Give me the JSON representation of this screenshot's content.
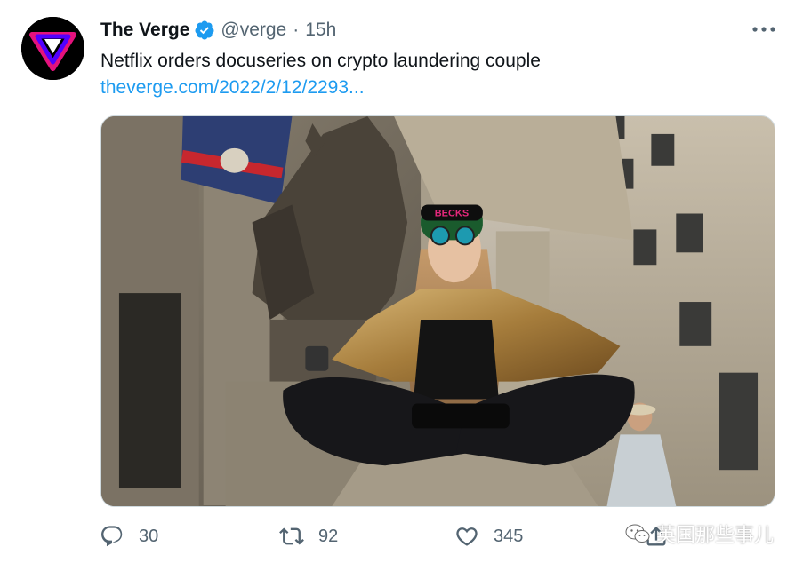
{
  "account": {
    "name": "The Verge",
    "handle": "@verge",
    "separator": "·",
    "time": "15h"
  },
  "tweet": {
    "text": "Netflix orders docuseries on crypto laundering couple",
    "link": "theverge.com/2022/2/12/2293..."
  },
  "media": {
    "hat_text": "BECKS"
  },
  "actions": {
    "replies": "30",
    "retweets": "92",
    "likes": "345"
  },
  "watermark": {
    "text": "英国那些事儿"
  },
  "icons": {
    "avatar": "verge-logo",
    "verified": "verified-badge-icon",
    "more": "more-icon",
    "reply": "reply-icon",
    "retweet": "retweet-icon",
    "like": "heart-icon",
    "share": "share-icon"
  },
  "colors": {
    "link": "#1d9bf0",
    "secondary_text": "#536471",
    "verified": "#1d9bf0"
  }
}
